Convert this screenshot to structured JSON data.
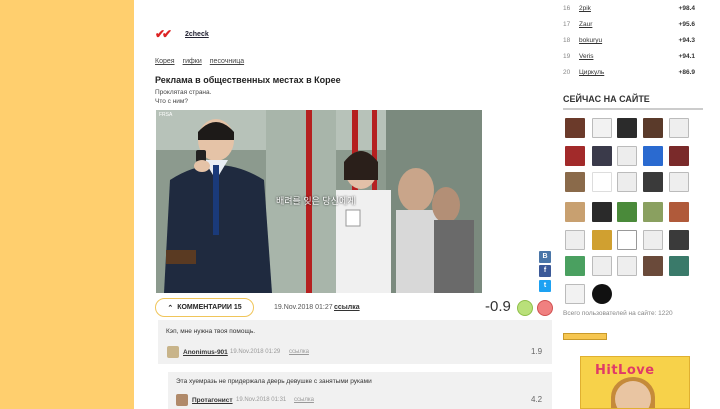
{
  "post": {
    "author": "2check",
    "tags": [
      "Корея",
      "гифки",
      "песочница"
    ],
    "title": "Реклама в общественных местах в Корее",
    "description": [
      "Проклятая страна.",
      "Что с ним?"
    ],
    "image_caption": "배려를 잊은 당신에게",
    "comments_label": "КОММЕНТАРИИ 15",
    "date": "19.Nov.2018 01:27",
    "link_label": "ссылка",
    "rating": "-0.9"
  },
  "share": {
    "vk": "В",
    "fb": "f",
    "tw": "t"
  },
  "comments": [
    {
      "text": "Кэп, мне нужна твоя помощь.",
      "author": "Anonimus-901",
      "date": "19.Nov.2018 01:29",
      "link_label": "ссылка",
      "rating": "1.9"
    },
    {
      "text": "Эта хуемразь не придержала дверь девушке с занятыми руками",
      "author": "Протагонист",
      "date": "19.Nov.2018 01:31",
      "link_label": "ссылка",
      "rating": "4.2"
    }
  ],
  "sidebar": {
    "ranking": [
      {
        "num": "16",
        "name": "2pik",
        "score": "+98.4"
      },
      {
        "num": "17",
        "name": "Zaur",
        "score": "+95.6"
      },
      {
        "num": "18",
        "name": "bokuryu",
        "score": "+94.3"
      },
      {
        "num": "19",
        "name": "Veris",
        "score": "+94.1"
      },
      {
        "num": "20",
        "name": "Циркуль",
        "score": "+86.9"
      }
    ],
    "now_title": "СЕЙЧАС НА САЙТЕ",
    "online_count": "Всего пользователей на сайте: 1220",
    "ad_logo": "HitLove"
  },
  "colors": {
    "left_bar": "#ffcf6e",
    "accent_border": "#f0c55a",
    "vk": "#4a76a8",
    "fb": "#3b5998",
    "tw": "#1da1f2",
    "smile_good": "#b9e07a",
    "smile_bad": "#f08080"
  }
}
